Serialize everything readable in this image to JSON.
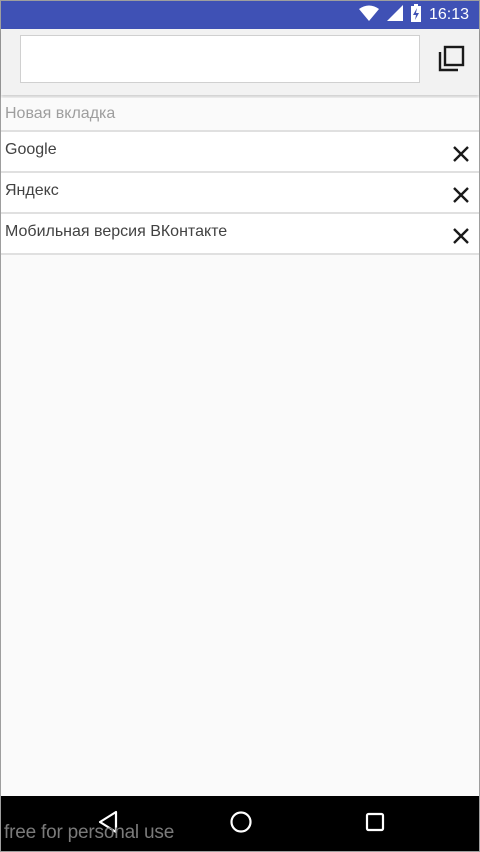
{
  "status_bar": {
    "time": "16:13",
    "icons": [
      "wifi-icon",
      "signal-icon",
      "battery-charging-icon"
    ],
    "background_color": "#3f51b5"
  },
  "toolbar": {
    "url_value": "",
    "url_placeholder": "",
    "tabs_button_icon": "tabs-switcher-icon"
  },
  "tabs": {
    "new_tab_label": "Новая вкладка",
    "items": [
      {
        "title": "Google",
        "close_icon": "close-icon"
      },
      {
        "title": "Яндекс",
        "close_icon": "close-icon"
      },
      {
        "title": "Мобильная версия ВКонтакте",
        "close_icon": "close-icon"
      }
    ]
  },
  "nav_bar": {
    "buttons": [
      "back-icon",
      "home-icon",
      "recent-apps-icon"
    ]
  },
  "watermark": "free for personal use"
}
